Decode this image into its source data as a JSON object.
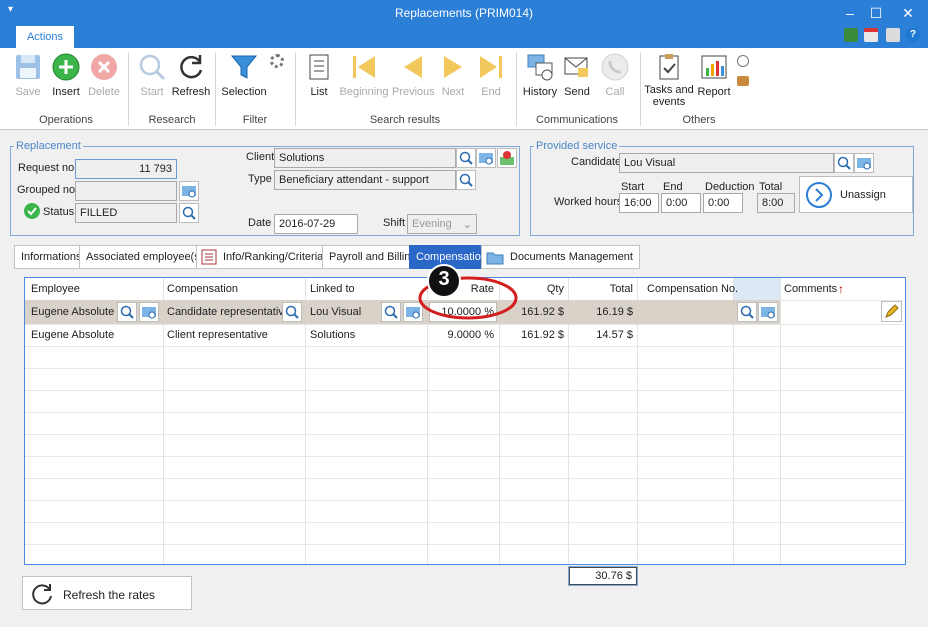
{
  "window": {
    "title": "Replacements (PRIM014)"
  },
  "ribbon": {
    "tab": "Actions",
    "buttons": {
      "save": "Save",
      "insert": "Insert",
      "delete": "Delete",
      "start": "Start",
      "refresh": "Refresh",
      "selection": "Selection",
      "list": "List",
      "beginning": "Beginning",
      "previous": "Previous",
      "next": "Next",
      "end": "End",
      "history": "History",
      "send": "Send",
      "call": "Call",
      "tasks": "Tasks and events",
      "report": "Report"
    },
    "groups": {
      "operations": "Operations",
      "research": "Research",
      "filter": "Filter",
      "search_results": "Search results",
      "communications": "Communications",
      "others": "Others"
    }
  },
  "replacement": {
    "legend": "Replacement",
    "request_label": "Request no.",
    "request_value": "11 793",
    "grouped_label": "Grouped no.",
    "grouped_value": "",
    "status_label": "Status",
    "status_value": "FILLED",
    "client_label": "Client",
    "client_value": "Solutions",
    "type_label": "Type",
    "type_value": "Beneficiary attendant - support",
    "date_label": "Date",
    "date_value": "2016-07-29",
    "shift_label": "Shift",
    "shift_value": "Evening"
  },
  "provided": {
    "legend": "Provided service",
    "candidate_label": "Candidate",
    "candidate_value": "Lou Visual",
    "worked_label": "Worked hours",
    "start_label": "Start",
    "start_value": "16:00",
    "end_label": "End",
    "end_value": "0:00",
    "deduction_label": "Deduction",
    "deduction_value": "0:00",
    "total_label": "Total",
    "total_value": "8:00",
    "unassign": "Unassign"
  },
  "tabs": [
    "Informations",
    "Associated employee(s)",
    "Info/Ranking/Criteria",
    "Payroll and Billing",
    "Compensation",
    "Documents Management"
  ],
  "grid": {
    "headers": {
      "employee": "Employee",
      "compensation": "Compensation",
      "linked": "Linked to",
      "rate": "Rate",
      "qty": "Qty",
      "total": "Total",
      "comp_no": "Compensation No.",
      "comments": "Comments"
    },
    "rows": [
      {
        "employee": "Eugene Absolute",
        "compensation": "Candidate representative",
        "linked": "Lou Visual",
        "rate": "10.0000 %",
        "qty": "161.92 $",
        "total": "16.19 $",
        "comp_no": ""
      },
      {
        "employee": "Eugene Absolute",
        "compensation": "Client representative",
        "linked": "Solutions",
        "rate": "9.0000 %",
        "qty": "161.92 $",
        "total": "14.57 $",
        "comp_no": ""
      }
    ],
    "sum_total": "30.76 $"
  },
  "callout": "3",
  "refresh_rates": "Refresh the rates"
}
